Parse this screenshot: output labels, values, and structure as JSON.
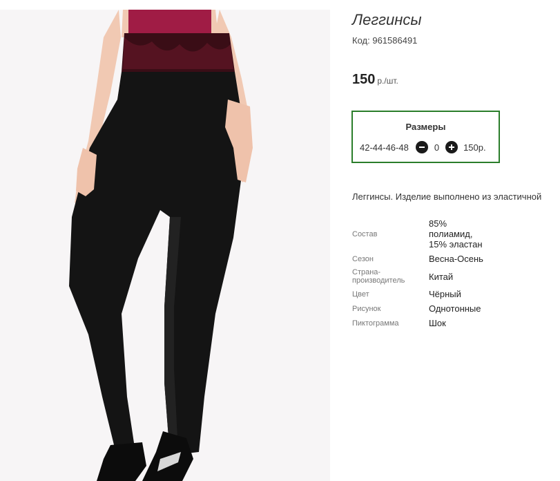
{
  "product": {
    "title": "Леггинсы",
    "code_label": "Код:",
    "code": "961586491",
    "price_value": "150",
    "price_unit": "р./шт.",
    "description": "Леггинсы. Изделие выполнено из эластичной"
  },
  "sizes": {
    "heading": "Размеры",
    "range": "42-44-46-48",
    "quantity": "0",
    "row_price": "150р.",
    "minus_icon": "minus-circle-icon",
    "plus_icon": "plus-circle-icon",
    "border_color": "#2a7d2a"
  },
  "properties": [
    {
      "key": "Состав",
      "value": "85% полиамид, 15% эластан"
    },
    {
      "key": "Сезон",
      "value": "Весна-Осень"
    },
    {
      "key": "Страна-производитель",
      "value": "Китай"
    },
    {
      "key": "Цвет",
      "value": "Чёрный"
    },
    {
      "key": "Рисунок",
      "value": "Однотонные"
    },
    {
      "key": "Пиктограмма",
      "value": "Шок"
    }
  ]
}
